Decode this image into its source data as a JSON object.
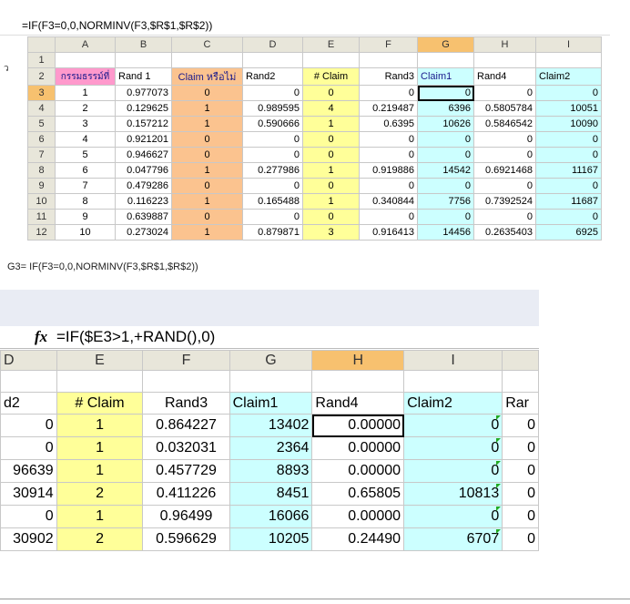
{
  "top": {
    "left_glyph": "ว",
    "left_glyph2": "",
    "formula": "=IF(F3=0,0,NORMINV(F3,$R$1,$R$2))",
    "columns": [
      "A",
      "B",
      "C",
      "D",
      "E",
      "F",
      "G",
      "H",
      "I"
    ],
    "rows": [
      "1",
      "2",
      "3",
      "4",
      "5",
      "6",
      "7",
      "8",
      "9",
      "10",
      "11",
      "12"
    ],
    "headers": [
      "กรรมธรรม์ที่",
      "Rand 1",
      "Claim หรือไม่",
      "Rand2",
      "# Claim",
      "Rand3",
      "Claim1",
      "Rand4",
      "Claim2"
    ],
    "data": [
      [
        "1",
        "0.977073",
        "0",
        "0",
        "0",
        "0",
        "0",
        "0",
        "0"
      ],
      [
        "2",
        "0.129625",
        "1",
        "0.989595",
        "4",
        "0.219487",
        "6396",
        "0.5805784",
        "10051"
      ],
      [
        "3",
        "0.157212",
        "1",
        "0.590666",
        "1",
        "0.6395",
        "10626",
        "0.5846542",
        "10090"
      ],
      [
        "4",
        "0.921201",
        "0",
        "0",
        "0",
        "0",
        "0",
        "0",
        "0"
      ],
      [
        "5",
        "0.946627",
        "0",
        "0",
        "0",
        "0",
        "0",
        "0",
        "0"
      ],
      [
        "6",
        "0.047796",
        "1",
        "0.277986",
        "1",
        "0.919886",
        "14542",
        "0.6921468",
        "11167"
      ],
      [
        "7",
        "0.479286",
        "0",
        "0",
        "0",
        "0",
        "0",
        "0",
        "0"
      ],
      [
        "8",
        "0.116223",
        "1",
        "0.165488",
        "1",
        "0.340844",
        "7756",
        "0.7392524",
        "11687"
      ],
      [
        "9",
        "0.639887",
        "0",
        "0",
        "0",
        "0",
        "0",
        "0",
        "0"
      ],
      [
        "10",
        "0.273024",
        "1",
        "0.879871",
        "3",
        "0.916413",
        "14456",
        "0.2635403",
        "6925"
      ]
    ]
  },
  "caption": "G3= IF(F3=0,0,NORMINV(F3,$R$1,$R$2))",
  "bottom": {
    "fx_label": "fx",
    "formula": "=IF($E3>1,+RAND(),0)",
    "columns": [
      "D",
      "E",
      "F",
      "G",
      "H",
      "I"
    ],
    "headers": [
      "d2",
      "# Claim",
      "Rand3",
      "Claim1",
      "Rand4",
      "Claim2",
      "Rar"
    ],
    "data": [
      [
        "0",
        "1",
        "0.864227",
        "13402",
        "0.00000",
        "0",
        "0"
      ],
      [
        "0",
        "1",
        "0.032031",
        "2364",
        "0.00000",
        "0",
        "0"
      ],
      [
        "96639",
        "1",
        "0.457729",
        "8893",
        "0.00000",
        "0",
        "0"
      ],
      [
        "30914",
        "2",
        "0.411226",
        "8451",
        "0.65805",
        "10813",
        "0"
      ],
      [
        "0",
        "1",
        "0.96499",
        "16066",
        "0.00000",
        "0",
        "0"
      ],
      [
        "30902",
        "2",
        "0.596629",
        "10205",
        "0.24490",
        "6707",
        "0"
      ]
    ]
  }
}
